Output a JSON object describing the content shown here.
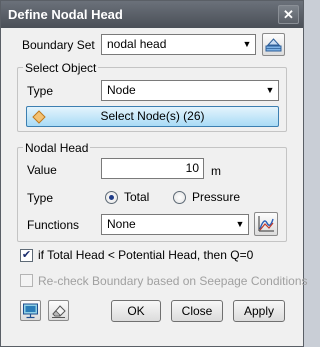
{
  "window": {
    "title": "Define Nodal Head",
    "close_glyph": "✕"
  },
  "boundary_set": {
    "label": "Boundary Set",
    "value": "nodal head",
    "manager_icon": "boundary-manager-icon"
  },
  "select_object": {
    "title": "Select Object",
    "type_label": "Type",
    "type_value": "Node",
    "select_button_label": "Select Node(s) (26)",
    "select_icon": "diamond-node-icon"
  },
  "nodal_head": {
    "title": "Nodal Head",
    "value_label": "Value",
    "value": "10",
    "unit": "m",
    "type_label": "Type",
    "type_options": [
      {
        "label": "Total",
        "selected": true
      },
      {
        "label": "Pressure",
        "selected": false
      }
    ],
    "functions_label": "Functions",
    "functions_value": "None",
    "function_icon": "function-graph-icon"
  },
  "options": {
    "total_head_check": {
      "label": "if Total Head < Potential Head, then Q=0",
      "checked": true
    },
    "recheck": {
      "label": "Re-check Boundary based on Seepage Conditions",
      "checked": false,
      "enabled": false
    }
  },
  "footer": {
    "buttons": {
      "ok": "OK",
      "close": "Close",
      "apply": "Apply"
    },
    "left_icons": [
      "display-icon",
      "eraser-icon"
    ]
  },
  "colors": {
    "titlebar": "#555a62",
    "select_button": "#a9dbf6",
    "radio_dot": "#1f3c88"
  }
}
